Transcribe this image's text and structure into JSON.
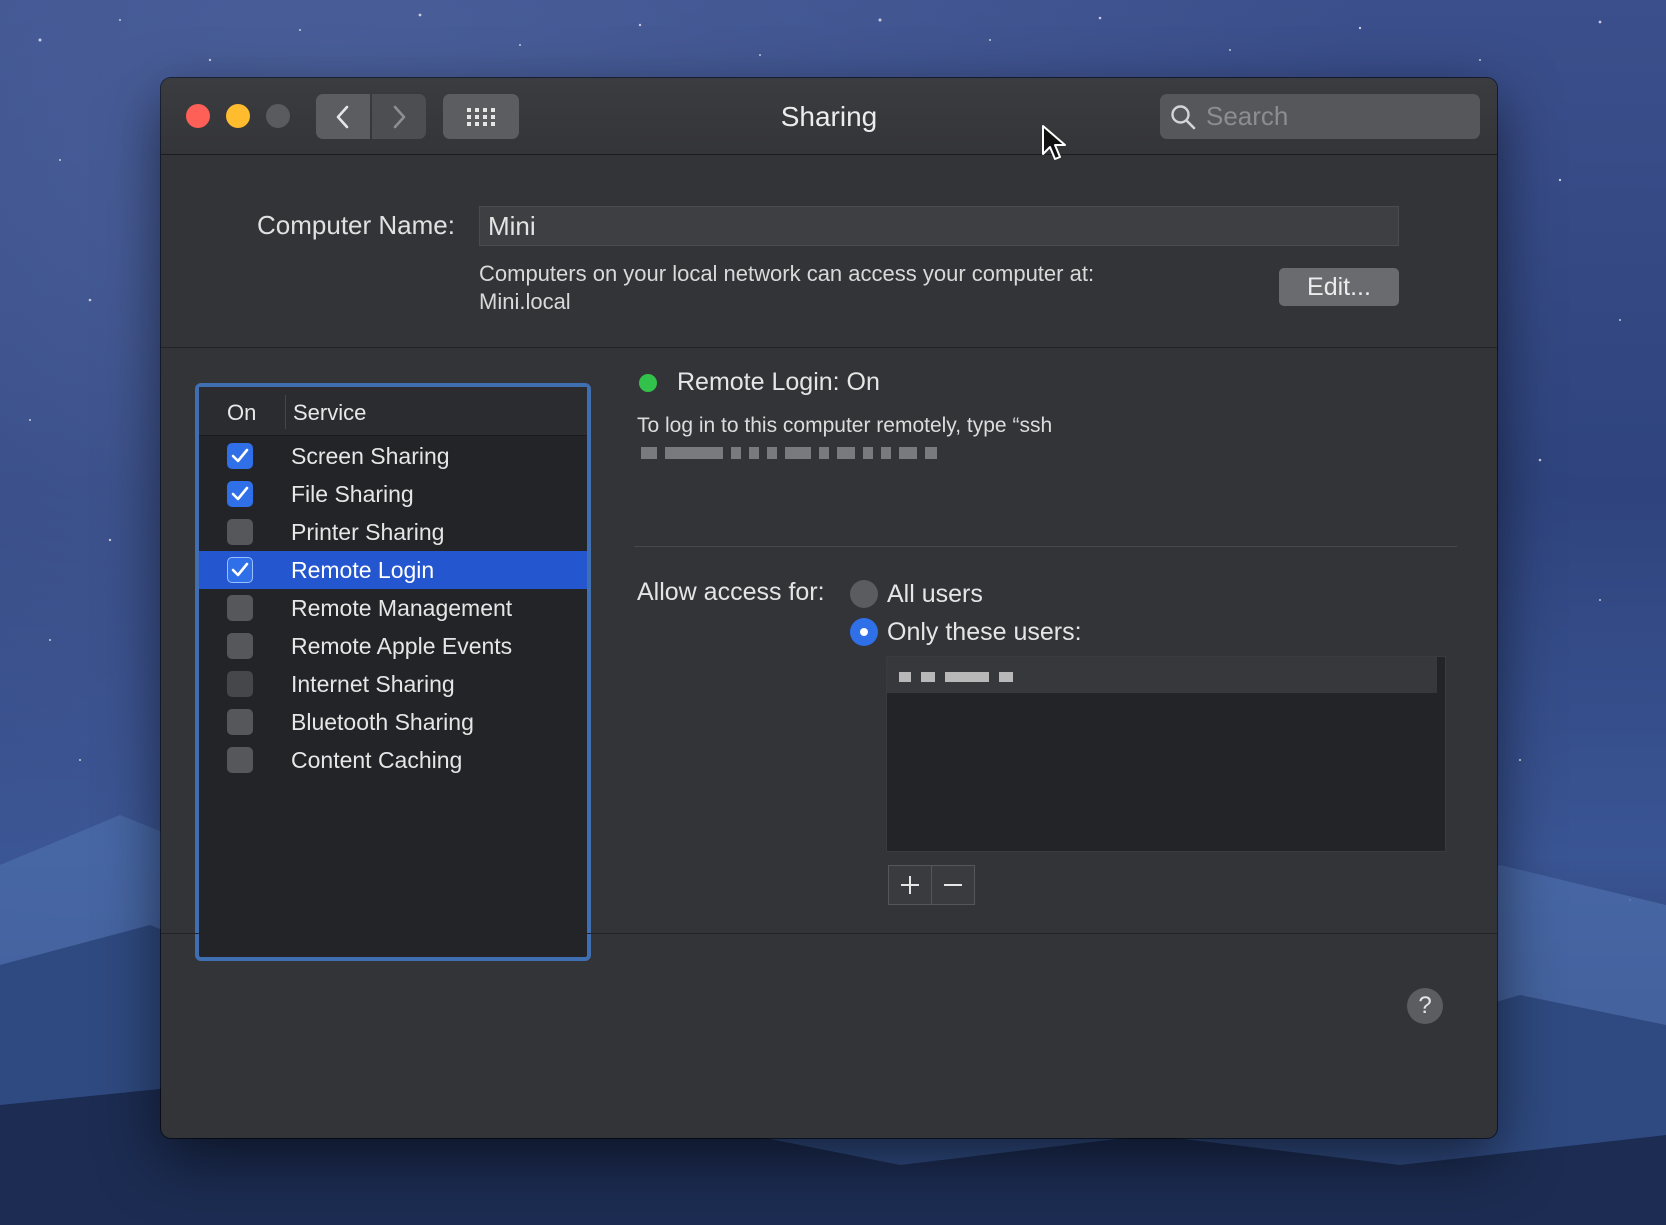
{
  "window": {
    "title": "Sharing",
    "search_placeholder": "Search"
  },
  "computer_name": {
    "label": "Computer Name:",
    "value": "Mini",
    "info_line1": "Computers on your local network can access your computer at:",
    "info_line2": "Mini.local",
    "edit_label": "Edit..."
  },
  "services": {
    "header_on": "On",
    "header_service": "Service",
    "items": [
      {
        "name": "Screen Sharing",
        "checked": true
      },
      {
        "name": "File Sharing",
        "checked": true
      },
      {
        "name": "Printer Sharing",
        "checked": false
      },
      {
        "name": "Remote Login",
        "checked": true,
        "selected": true
      },
      {
        "name": "Remote Management",
        "checked": false
      },
      {
        "name": "Remote Apple Events",
        "checked": false
      },
      {
        "name": "Internet Sharing",
        "checked": false
      },
      {
        "name": "Bluetooth Sharing",
        "checked": false
      },
      {
        "name": "Content Caching",
        "checked": false
      }
    ]
  },
  "detail": {
    "status": "Remote Login: On",
    "status_color": "#32c14a",
    "hint": "To log in to this computer remotely, type “ssh",
    "allow_label": "Allow access for:",
    "option_all": "All users",
    "option_only": "Only these users:",
    "selected_option": "Only these users:"
  },
  "help_label": "?",
  "colors": {
    "accent": "#2f6fe8",
    "selection": "#2457cf",
    "close": "#fe5f57",
    "minimize": "#febc2e"
  }
}
